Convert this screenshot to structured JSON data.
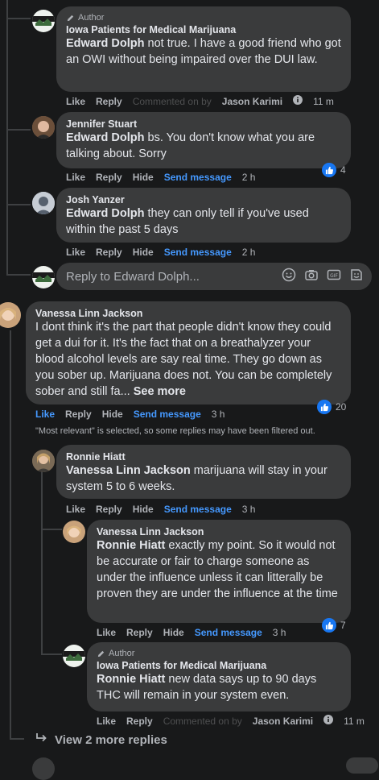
{
  "comments": [
    {
      "author_tag": "Author",
      "name": "Iowa Patients for Medical Marijuana",
      "mention": "Edward Dolph",
      "text": " not true. I have a good friend who got an OWI without being impaired over the DUI law.",
      "like": "Like",
      "reply": "Reply",
      "ghost": "Commented on by",
      "tagged_name": "Jason Karimi",
      "time": "11 m"
    },
    {
      "name": "Jennifer Stuart",
      "mention": "Edward Dolph",
      "text": " bs. You don't know what you are talking about. Sorry",
      "like": "Like",
      "reply": "Reply",
      "hide": "Hide",
      "send": "Send message",
      "time": "2 h",
      "reactions": "4"
    },
    {
      "name": "Josh Yanzer",
      "mention": "Edward Dolph",
      "text": " they can only tell if you've used within the past 5 days",
      "like": "Like",
      "reply": "Reply",
      "hide": "Hide",
      "send": "Send message",
      "time": "2 h"
    },
    {
      "name": "Vanessa Linn Jackson",
      "text": "I dont think it's the part that people didn't know they could get a dui for it. It's the fact that on a breathalyzer your blood alcohol levels are say real time. They go down as you sober up. Marijuana does not. You can be completely sober and still fa...",
      "see_more": "See more",
      "like": "Like",
      "reply": "Reply",
      "hide": "Hide",
      "send": "Send message",
      "time": "3 h",
      "reactions": "20"
    },
    {
      "name": "Ronnie Hiatt",
      "mention": "Vanessa Linn Jackson",
      "text": " marijuana will stay in your system 5 to 6 weeks.",
      "like": "Like",
      "reply": "Reply",
      "hide": "Hide",
      "send": "Send message",
      "time": "3 h"
    },
    {
      "name": "Vanessa Linn Jackson",
      "mention": "Ronnie Hiatt",
      "text": " exactly my point. So it would not be accurate or fair to charge someone as under the influence unless it can litterally be proven they are under the influence at the time",
      "like": "Like",
      "reply": "Reply",
      "hide": "Hide",
      "send": "Send message",
      "time": "3 h",
      "reactions": "7"
    },
    {
      "author_tag": "Author",
      "name": "Iowa Patients for Medical Marijuana",
      "mention": "Ronnie Hiatt",
      "text": " new data says up to 90 days THC will remain in your system even.",
      "like": "Like",
      "reply": "Reply",
      "ghost": "Commented on by",
      "tagged_name": "Jason Karimi",
      "time": "11 m"
    }
  ],
  "reply_box": {
    "placeholder": "Reply to Edward Dolph..."
  },
  "filter_note": "\"Most relevant\" is selected, so some replies may have been filtered out.",
  "view_more": "View 2 more replies",
  "colors": {
    "background": "#18191a",
    "bubble": "#3a3b3c",
    "link": "#4599ff",
    "like_badge": "#1877f2"
  }
}
